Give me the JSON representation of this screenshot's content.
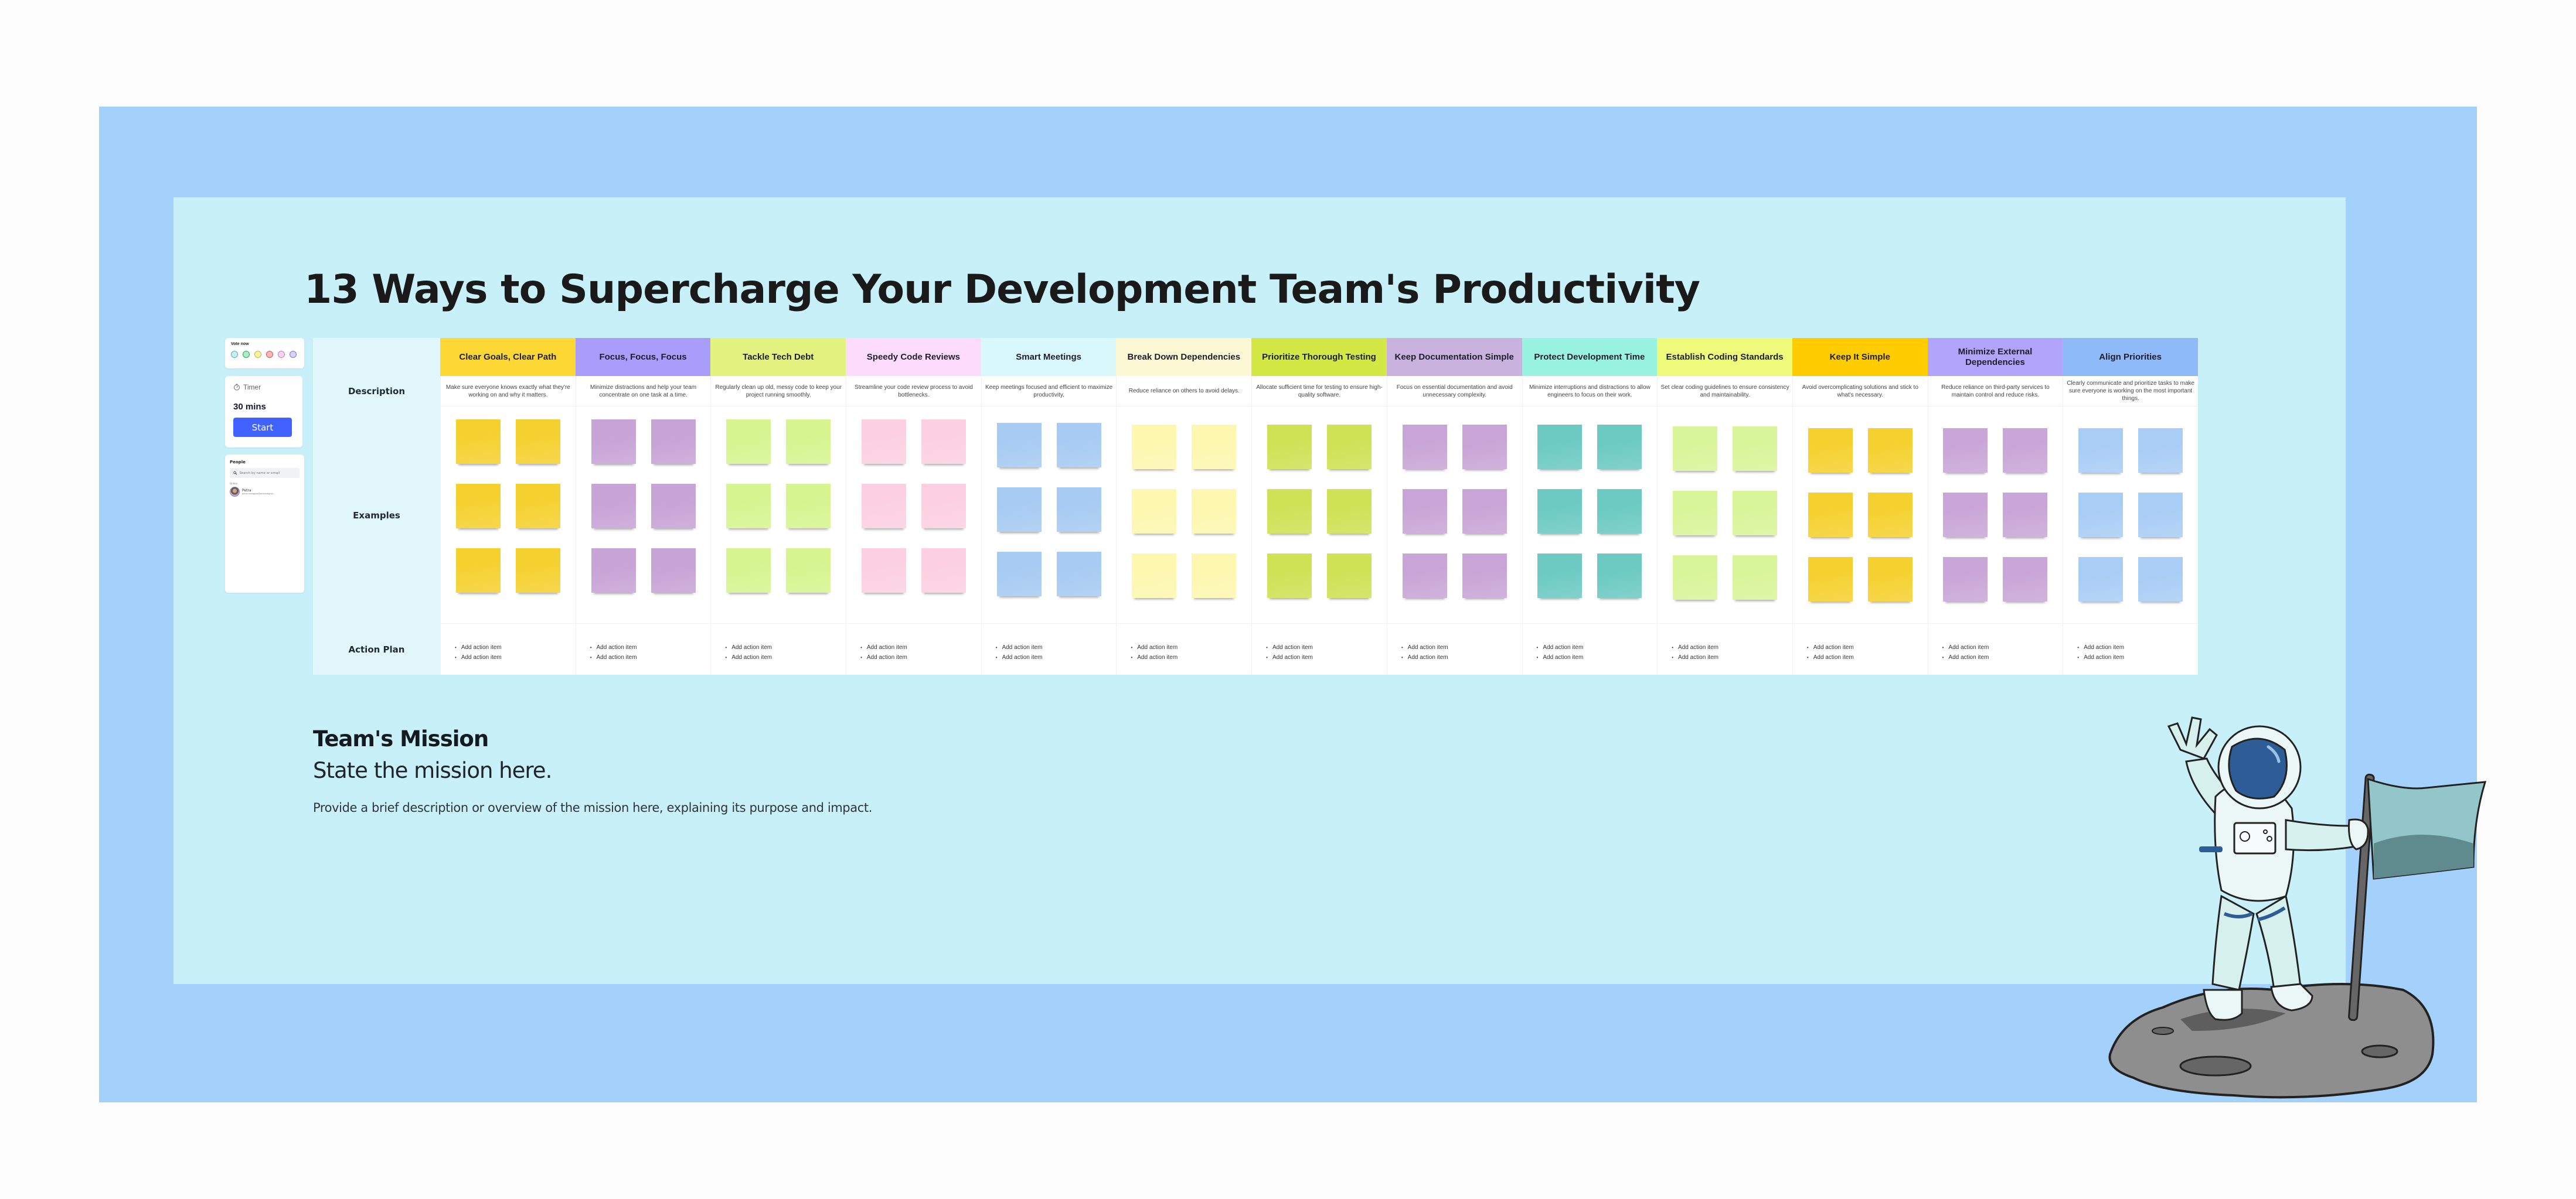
{
  "board": {
    "title": "13 Ways to Supercharge Your Development Team's Productivity",
    "row_labels": {
      "description": "Description",
      "examples": "Examples",
      "action_plan": "Action Plan"
    },
    "columns": [
      {
        "title": "Clear Goals, Clear Path",
        "description": "Make sure everyone knows exactly what they're working on and why it matters.",
        "header_color": "#fdd835",
        "sticky_color": "#f5d130",
        "sticky_count": 6,
        "actions": [
          "Add action item",
          "Add action item"
        ]
      },
      {
        "title": "Focus, Focus, Focus",
        "description": "Minimize distractions and help your team concentrate on one task at a time.",
        "header_color": "#a99cfb",
        "sticky_color": "#c7a3d6",
        "sticky_count": 6,
        "actions": [
          "Add action item",
          "Add action item"
        ]
      },
      {
        "title": "Tackle Tech Debt",
        "description": "Regularly clean up old, messy code to keep your project running smoothly.",
        "header_color": "#e2f47f",
        "sticky_color": "#d6f590",
        "sticky_count": 6,
        "actions": [
          "Add action item",
          "Add action item"
        ]
      },
      {
        "title": "Speedy Code Reviews",
        "description": "Streamline your code review process to avoid bottlenecks.",
        "header_color": "#fddcfb",
        "sticky_color": "#fcd0e0",
        "sticky_count": 6,
        "actions": [
          "Add action item",
          "Add action item"
        ]
      },
      {
        "title": "Smart Meetings",
        "description": "Keep meetings focused and efficient to maximize productivity.",
        "header_color": "#d8f8fb",
        "sticky_color": "#a7cbf2",
        "sticky_count": 6,
        "actions": [
          "Add action item",
          "Add action item"
        ]
      },
      {
        "title": "Break Down Dependencies",
        "description": "Reduce reliance on others to avoid delays.",
        "header_color": "#fdf8d4",
        "sticky_color": "#fdf7b0",
        "sticky_count": 6,
        "actions": [
          "Add action item",
          "Add action item"
        ]
      },
      {
        "title": "Prioritize Thorough Testing",
        "description": "Allocate sufficient time for testing to ensure high-quality software.",
        "header_color": "#d3e845",
        "sticky_color": "#cde255",
        "sticky_count": 6,
        "actions": [
          "Add action item",
          "Add action item"
        ]
      },
      {
        "title": "Keep Documentation Simple",
        "description": "Focus on essential documentation and avoid unnecessary complexity.",
        "header_color": "#c9b2de",
        "sticky_color": "#c8a5d6",
        "sticky_count": 6,
        "actions": [
          "Add action item",
          "Add action item"
        ]
      },
      {
        "title": "Protect Development Time",
        "description": "Minimize interruptions and distractions to allow engineers to focus on their work.",
        "header_color": "#98f3e1",
        "sticky_color": "#6ccac2",
        "sticky_count": 6,
        "actions": [
          "Add action item",
          "Add action item"
        ]
      },
      {
        "title": "Establish Coding Standards",
        "description": "Set clear coding guidelines to ensure consistency and maintainability.",
        "header_color": "#eefa7a",
        "sticky_color": "#d9f59a",
        "sticky_count": 6,
        "actions": [
          "Add action item",
          "Add action item"
        ]
      },
      {
        "title": "Keep It Simple",
        "description": "Avoid overcomplicating solutions and stick to what's necessary.",
        "header_color": "#ffcc00",
        "sticky_color": "#f5d130",
        "sticky_count": 6,
        "actions": [
          "Add action item",
          "Add action item"
        ]
      },
      {
        "title": "Minimize External Dependencies",
        "description": "Reduce reliance on third-party services to maintain control and reduce risks.",
        "header_color": "#b2a4fb",
        "sticky_color": "#c9a6d7",
        "sticky_count": 6,
        "actions": [
          "Add action item",
          "Add action item"
        ]
      },
      {
        "title": "Align Priorities",
        "description": "Clearly communicate and prioritize tasks to make sure everyone is working on the most important things.",
        "header_color": "#8fbaf9",
        "sticky_color": "#a9cdf5",
        "sticky_count": 6,
        "actions": [
          "Add action item",
          "Add action item"
        ]
      }
    ]
  },
  "sidebar": {
    "vote": {
      "label": "Vote now",
      "options": [
        {
          "color": "#c9f1f5",
          "border": "#5aa9b4"
        },
        {
          "color": "#a6f0c3",
          "border": "#3d9a5f"
        },
        {
          "color": "#fbf3a0",
          "border": "#c4b74b"
        },
        {
          "color": "#fcb4b4",
          "border": "#c45a5a"
        },
        {
          "color": "#f9d1f6",
          "border": "#b984b4"
        },
        {
          "color": "#d5d3fb",
          "border": "#7b79c4"
        }
      ]
    },
    "timer": {
      "label": "Timer",
      "value": "30 mins",
      "start_label": "Start"
    },
    "people": {
      "label": "People",
      "search_placeholder": "Search by name or email",
      "online_label": "Online",
      "users": [
        {
          "name": "Petra",
          "email": "petra.ivanigova@actumdigital..."
        }
      ]
    }
  },
  "mission": {
    "title": "Team's Mission",
    "statement": "State the mission here.",
    "description": "Provide a brief description or overview of the mission here, explaining its purpose and impact."
  },
  "colors": {
    "outer_frame": "#a3d1fc",
    "inner_frame": "#c8f0f8",
    "row_label_bg": "#e2f7fc",
    "start_button": "#4262ff"
  }
}
